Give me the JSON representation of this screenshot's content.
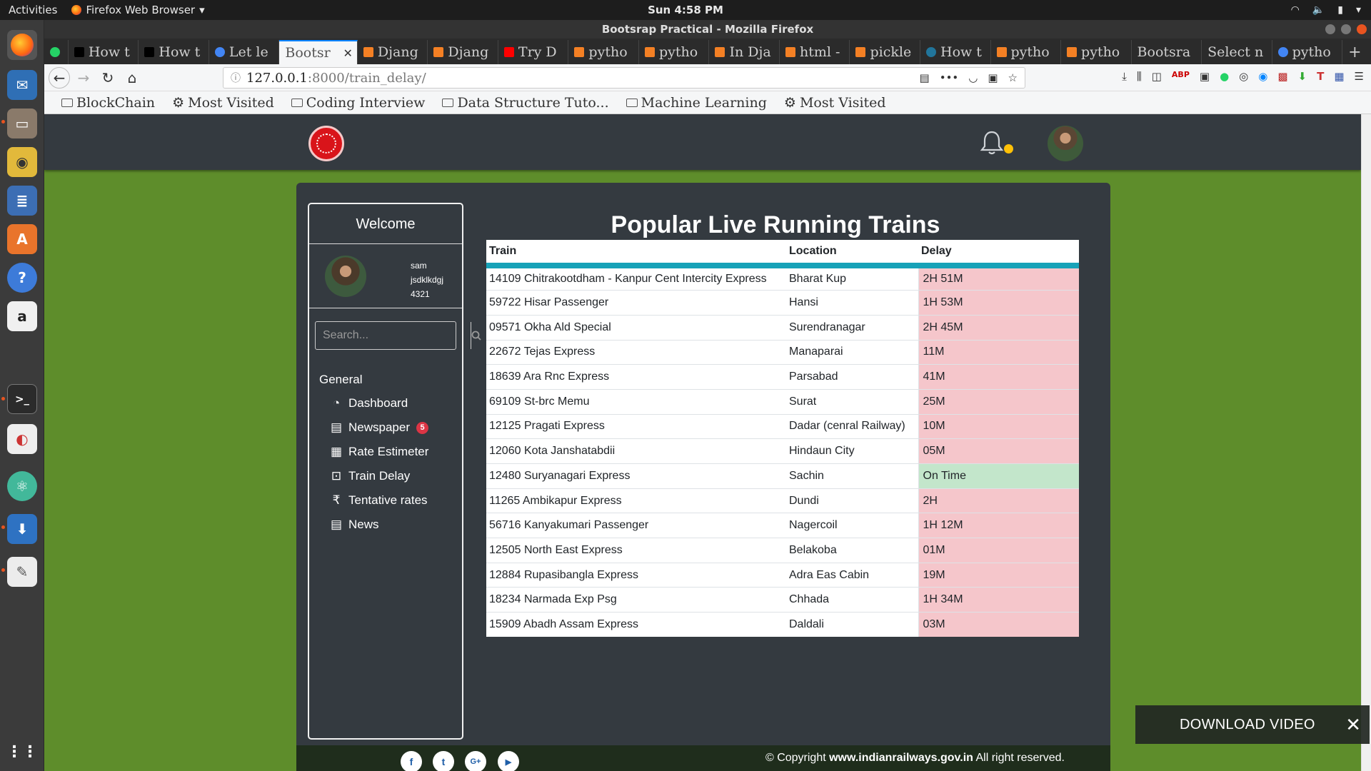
{
  "topbar": {
    "activities": "Activities",
    "app_menu": "Firefox Web Browser",
    "clock": "Sun  4:58 PM"
  },
  "dock": {
    "items": [
      "firefox-icon",
      "thunderbird-icon",
      "files-icon",
      "rhythmbox-icon",
      "libreoffice-writer-icon",
      "software-center-icon",
      "help-icon",
      "amazon-icon",
      "terminal-icon",
      "eclipse-icon",
      "atom-icon",
      "downloader-icon",
      "text-editor-icon",
      "show-apps-icon"
    ]
  },
  "window": {
    "title": "Bootsrap Practical - Mozilla Firefox"
  },
  "tabs": [
    {
      "label": "",
      "favicon_color": "#25d366",
      "active": false
    },
    {
      "label": "How t",
      "favicon_color": "#000000",
      "active": false
    },
    {
      "label": "How t",
      "favicon_color": "#000000",
      "active": false
    },
    {
      "label": "Let le",
      "favicon_color": "#4285f4",
      "active": false
    },
    {
      "label": "Bootsr",
      "favicon_color": "#e8e8e8",
      "active": true
    },
    {
      "label": "Djang",
      "favicon_color": "#f48024",
      "active": false
    },
    {
      "label": "Djang",
      "favicon_color": "#f48024",
      "active": false
    },
    {
      "label": "Try D",
      "favicon_color": "#ff0000",
      "active": false
    },
    {
      "label": "pytho",
      "favicon_color": "#f48024",
      "active": false
    },
    {
      "label": "pytho",
      "favicon_color": "#f48024",
      "active": false
    },
    {
      "label": "In Dja",
      "favicon_color": "#f48024",
      "active": false
    },
    {
      "label": "html -",
      "favicon_color": "#f48024",
      "active": false
    },
    {
      "label": "pickle",
      "favicon_color": "#f48024",
      "active": false
    },
    {
      "label": "How t",
      "favicon_color": "#21759b",
      "active": false
    },
    {
      "label": "pytho",
      "favicon_color": "#f48024",
      "active": false
    },
    {
      "label": "pytho",
      "favicon_color": "#f48024",
      "active": false
    },
    {
      "label": "Bootsra",
      "favicon_color": "",
      "active": false
    },
    {
      "label": "Select n",
      "favicon_color": "",
      "active": false
    },
    {
      "label": "pytho",
      "favicon_color": "#4285f4",
      "active": false
    }
  ],
  "url": {
    "host": "127.0.0.1",
    "path": ":8000/train_delay/"
  },
  "bookmarks": [
    {
      "label": "BlockChain",
      "icon": "folder-icon"
    },
    {
      "label": "Most Visited",
      "icon": "gear-icon"
    },
    {
      "label": "Coding Interview",
      "icon": "folder-icon"
    },
    {
      "label": "Data Structure Tuto...",
      "icon": "folder-icon"
    },
    {
      "label": "Machine Learning",
      "icon": "folder-icon"
    },
    {
      "label": "Most Visited",
      "icon": "gear-icon"
    }
  ],
  "sidebar": {
    "welcome": "Welcome",
    "user": {
      "name": "sam",
      "handle": "jsdklkdgj",
      "number": "4321"
    },
    "search_placeholder": "Search...",
    "section": "General",
    "items": [
      {
        "label": "Dashboard",
        "icon": "dashboard-icon",
        "badge": ""
      },
      {
        "label": "Newspaper",
        "icon": "newspaper-icon",
        "badge": "5"
      },
      {
        "label": "Rate Estimeter",
        "icon": "calculator-icon",
        "badge": ""
      },
      {
        "label": "Train Delay",
        "icon": "train-icon",
        "badge": ""
      },
      {
        "label": "Tentative rates",
        "icon": "rupee-icon",
        "badge": ""
      },
      {
        "label": "News",
        "icon": "newspaper-icon",
        "badge": ""
      }
    ]
  },
  "main": {
    "title": "Popular Live Running Trains",
    "columns": [
      "Train",
      "Location",
      "Delay"
    ],
    "rows": [
      {
        "train": "14109 Chitrakootdham - Kanpur Cent Intercity Express",
        "location": "Bharat Kup",
        "delay": "2H 51M",
        "on_time": false
      },
      {
        "train": "59722 Hisar Passenger",
        "location": "Hansi",
        "delay": "1H 53M",
        "on_time": false
      },
      {
        "train": "09571 Okha Ald Special",
        "location": "Surendranagar",
        "delay": "2H 45M",
        "on_time": false
      },
      {
        "train": "22672 Tejas Express",
        "location": "Manaparai",
        "delay": "11M",
        "on_time": false
      },
      {
        "train": "18639 Ara Rnc Express",
        "location": "Parsabad",
        "delay": "41M",
        "on_time": false
      },
      {
        "train": "69109 St-brc Memu",
        "location": "Surat",
        "delay": "25M",
        "on_time": false
      },
      {
        "train": "12125 Pragati Express",
        "location": "Dadar (cenral Railway)",
        "delay": "10M",
        "on_time": false
      },
      {
        "train": "12060 Kota Janshatabdii",
        "location": "Hindaun City",
        "delay": "05M",
        "on_time": false
      },
      {
        "train": "12480 Suryanagari Express",
        "location": "Sachin",
        "delay": "On Time",
        "on_time": true
      },
      {
        "train": "11265 Ambikapur Express",
        "location": "Dundi",
        "delay": "2H",
        "on_time": false
      },
      {
        "train": "56716 Kanyakumari Passenger",
        "location": "Nagercoil",
        "delay": "1H 12M",
        "on_time": false
      },
      {
        "train": "12505 North East Express",
        "location": "Belakoba",
        "delay": "01M",
        "on_time": false
      },
      {
        "train": "12884 Rupasibangla Express",
        "location": "Adra Eas Cabin",
        "delay": "19M",
        "on_time": false
      },
      {
        "train": "18234 Narmada Exp Psg",
        "location": "Chhada",
        "delay": "1H 34M",
        "on_time": false
      },
      {
        "train": "15909 Abadh Assam Express",
        "location": "Daldali",
        "delay": "03M",
        "on_time": false
      }
    ]
  },
  "footer": {
    "social": [
      {
        "icon": "facebook-icon",
        "glyph": "f"
      },
      {
        "icon": "twitter-icon",
        "glyph": "t"
      },
      {
        "icon": "google-plus-icon",
        "glyph": "G+"
      },
      {
        "icon": "youtube-icon",
        "glyph": "▶"
      }
    ],
    "copyright_prefix": "© Copyright ",
    "copyright_site": "www.indianrailways.gov.in",
    "copyright_suffix": " All right reserved."
  },
  "download_video": {
    "label": "DOWNLOAD VIDEO"
  },
  "colors": {
    "page_bg": "#5e8d2b",
    "panel": "#343a40",
    "table_header_rule": "#17a2b8",
    "delay_late": "#f5c6cb",
    "delay_on_time": "#c3e6cb",
    "badge": "#dc3545",
    "notification_dot": "#ffc107",
    "logo_red": "#d9141a"
  }
}
